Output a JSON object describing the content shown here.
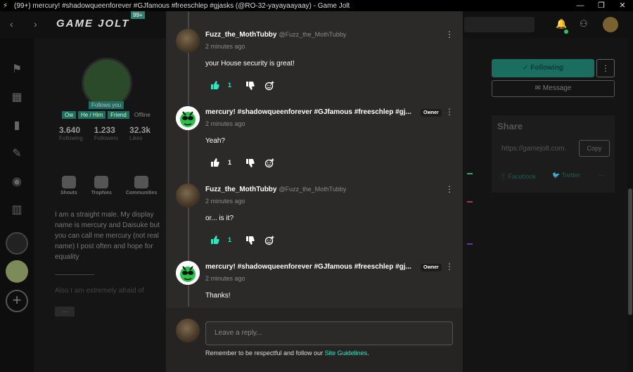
{
  "window": {
    "title": "(99+) mercury! #shadowqueenforever #GJfamous #freeschlep #gjasks (@RO-32-yayayaayaay) - Game Jolt",
    "controls": [
      "—",
      "❐",
      "✕"
    ]
  },
  "topnav": {
    "logo": "GAME JOLT",
    "badge": "99+"
  },
  "profile": {
    "follows_you": "Follows you",
    "chips": [
      "Ow",
      "He / Him",
      "Friend",
      "Offline"
    ],
    "stats": [
      {
        "value": "3.640",
        "label": "Following"
      },
      {
        "value": "1.233",
        "label": "Followers"
      },
      {
        "value": "32.3k",
        "label": "Likes"
      }
    ],
    "actions": [
      "Shouts",
      "Trophies",
      "Communities"
    ],
    "bio": "I am a straight male. My display name is mercury and Daisuke but you can call me mercury (not real name) I post often and hope for equality",
    "bio2": "Also I am extremely afraid of",
    "more": "..."
  },
  "right": {
    "following": "Following",
    "message": "Message",
    "share_title": "Share",
    "share_url": "https://gamejolt.com.",
    "copy": "Copy",
    "facebook": "Facebook",
    "twitter": "Twitter"
  },
  "comments": [
    {
      "name": "Fuzz_the_MothTubby",
      "handle": "@Fuzz_the_MothTubby",
      "time": "2 minutes ago",
      "text": "your House security is great!",
      "likes": "1",
      "owner": "",
      "liked": true,
      "avatar": "fuzz"
    },
    {
      "name": "mercury! #shadowqueenforever #GJfamous #freeschlep #gj...",
      "handle": "",
      "time": "2 minutes ago",
      "text": "Yeah?",
      "likes": "1",
      "owner": "Owner",
      "liked": false,
      "avatar": "merc"
    },
    {
      "name": "Fuzz_the_MothTubby",
      "handle": "@Fuzz_the_MothTubby",
      "time": "2 minutes ago",
      "text": "or... is it?",
      "likes": "1",
      "owner": "",
      "liked": true,
      "avatar": "fuzz"
    },
    {
      "name": "mercury! #shadowqueenforever #GJfamous #freeschlep #gj...",
      "handle": "",
      "time": "2 minutes ago",
      "text": "Thanks!",
      "likes": "",
      "owner": "Owner",
      "liked": true,
      "avatar": "merc"
    }
  ],
  "reply": {
    "placeholder": "Leave a reply...",
    "guidelines_prefix": "Remember to be respectful and follow our ",
    "guidelines_link": "Site Guidelines",
    "guidelines_suffix": "."
  },
  "colors": {
    "accent": "#2fe6c0",
    "modal_bg": "#2c2a29"
  }
}
